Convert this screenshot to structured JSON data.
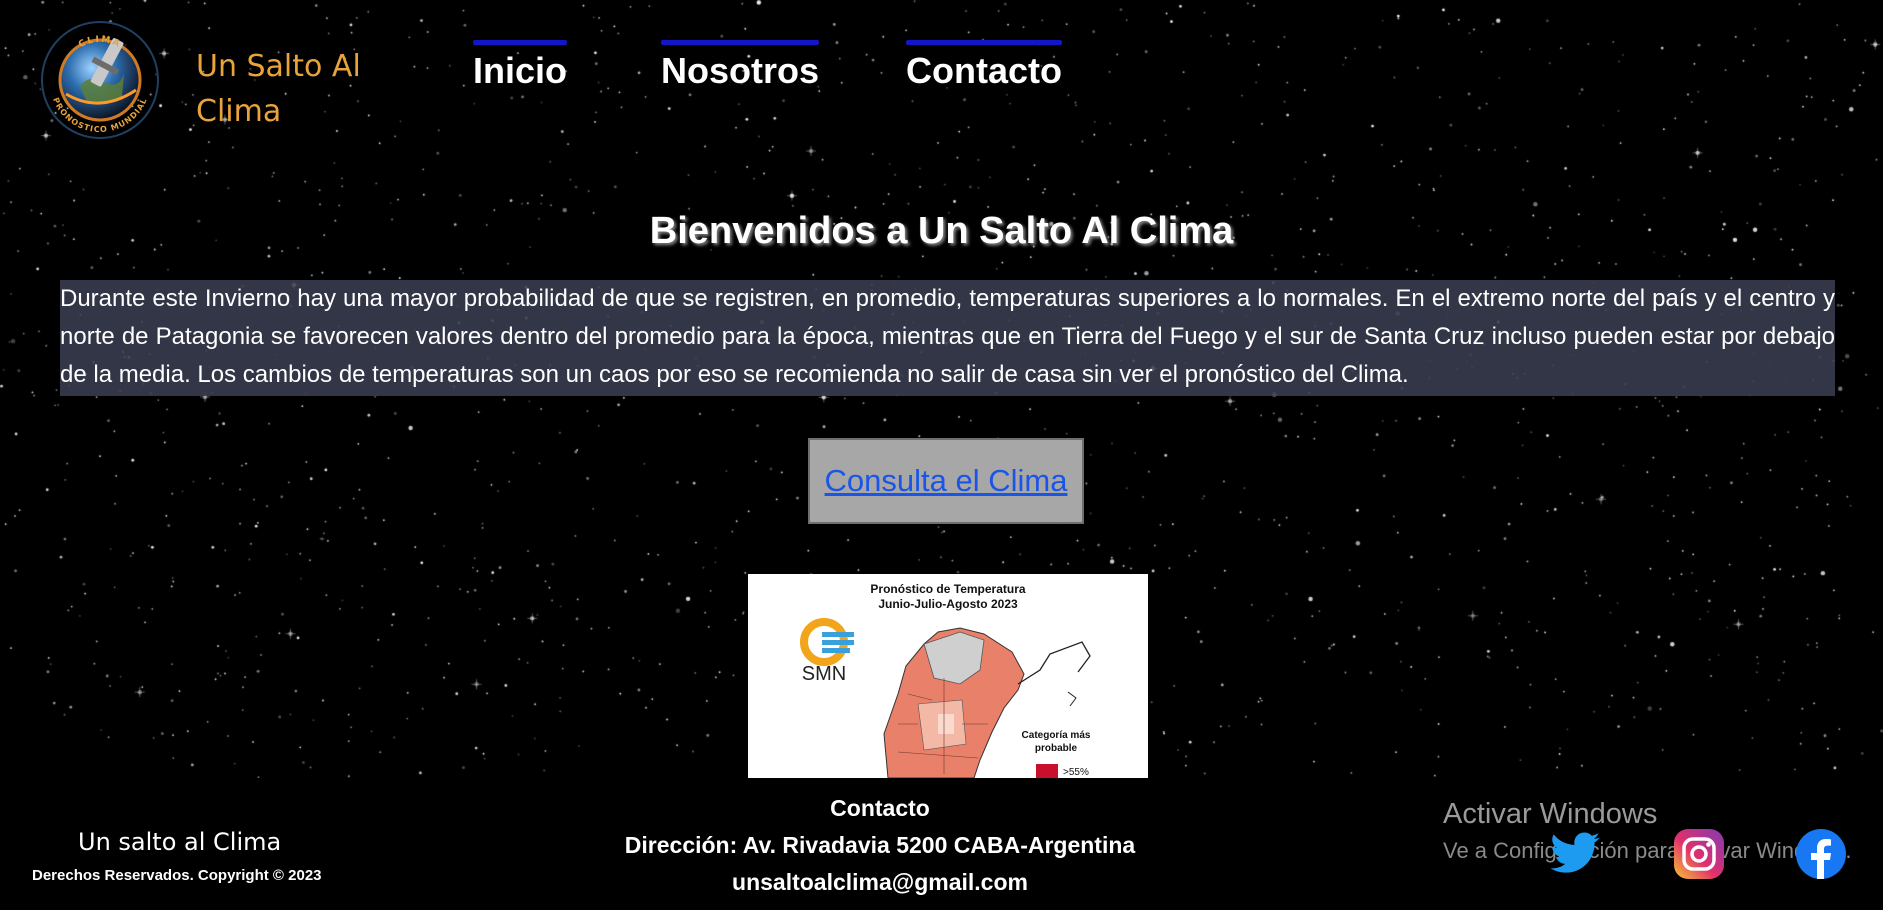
{
  "header": {
    "logo": {
      "top_text": "CLIMA",
      "bottom_text": "PRONOSTICO MUNDIAL",
      "icon": "satellite-globe-logo"
    },
    "brand_line1": "Un Salto Al",
    "brand_line2": "Clima",
    "nav": [
      "Inicio",
      "Nosotros",
      "Contacto"
    ]
  },
  "main": {
    "title": "Bienvenidos a Un Salto Al Clima",
    "intro": "Durante este Invierno hay una mayor probabilidad de que se registren, en promedio, temperaturas superiores a lo normales. En el extremo norte del país y el centro y norte de Patagonia se favorecen valores dentro del promedio para la época, mientras que en Tierra del Fuego y el sur de Santa Cruz incluso pueden estar por debajo de la media. Los cambios de temperaturas son un caos por eso se recomienda no salir de casa sin ver el pronóstico del Clima.",
    "cta": "Consulta el Clima",
    "forecast_image": {
      "title_line1": "Pronóstico de Temperatura",
      "title_line2": "Junio-Julio-Agosto 2023",
      "agency": "SMN",
      "legend_line1": "Categoría más",
      "legend_line2": "probable",
      "legend_item": ">55%"
    }
  },
  "footer": {
    "brand": "Un salto al Clima",
    "copyright": "Derechos Reservados. Copyright © 2023",
    "contact_title": "Contacto",
    "address": "Dirección: Av. Rivadavia 5200 CABA-Argentina",
    "email": "unsaltoalclima@gmail.com",
    "social": [
      "twitter-icon",
      "instagram-icon",
      "facebook-icon"
    ]
  },
  "overlay": {
    "line1": "Activar Windows",
    "line2": "Ve a Configuración para activar Windows."
  },
  "colors": {
    "background": "#000000",
    "brand": "#e8a33b",
    "nav_bar": "#1515c8",
    "cta_bg": "#a7a7a7",
    "link": "#1a55e8",
    "map_warm": "#e8806a"
  }
}
